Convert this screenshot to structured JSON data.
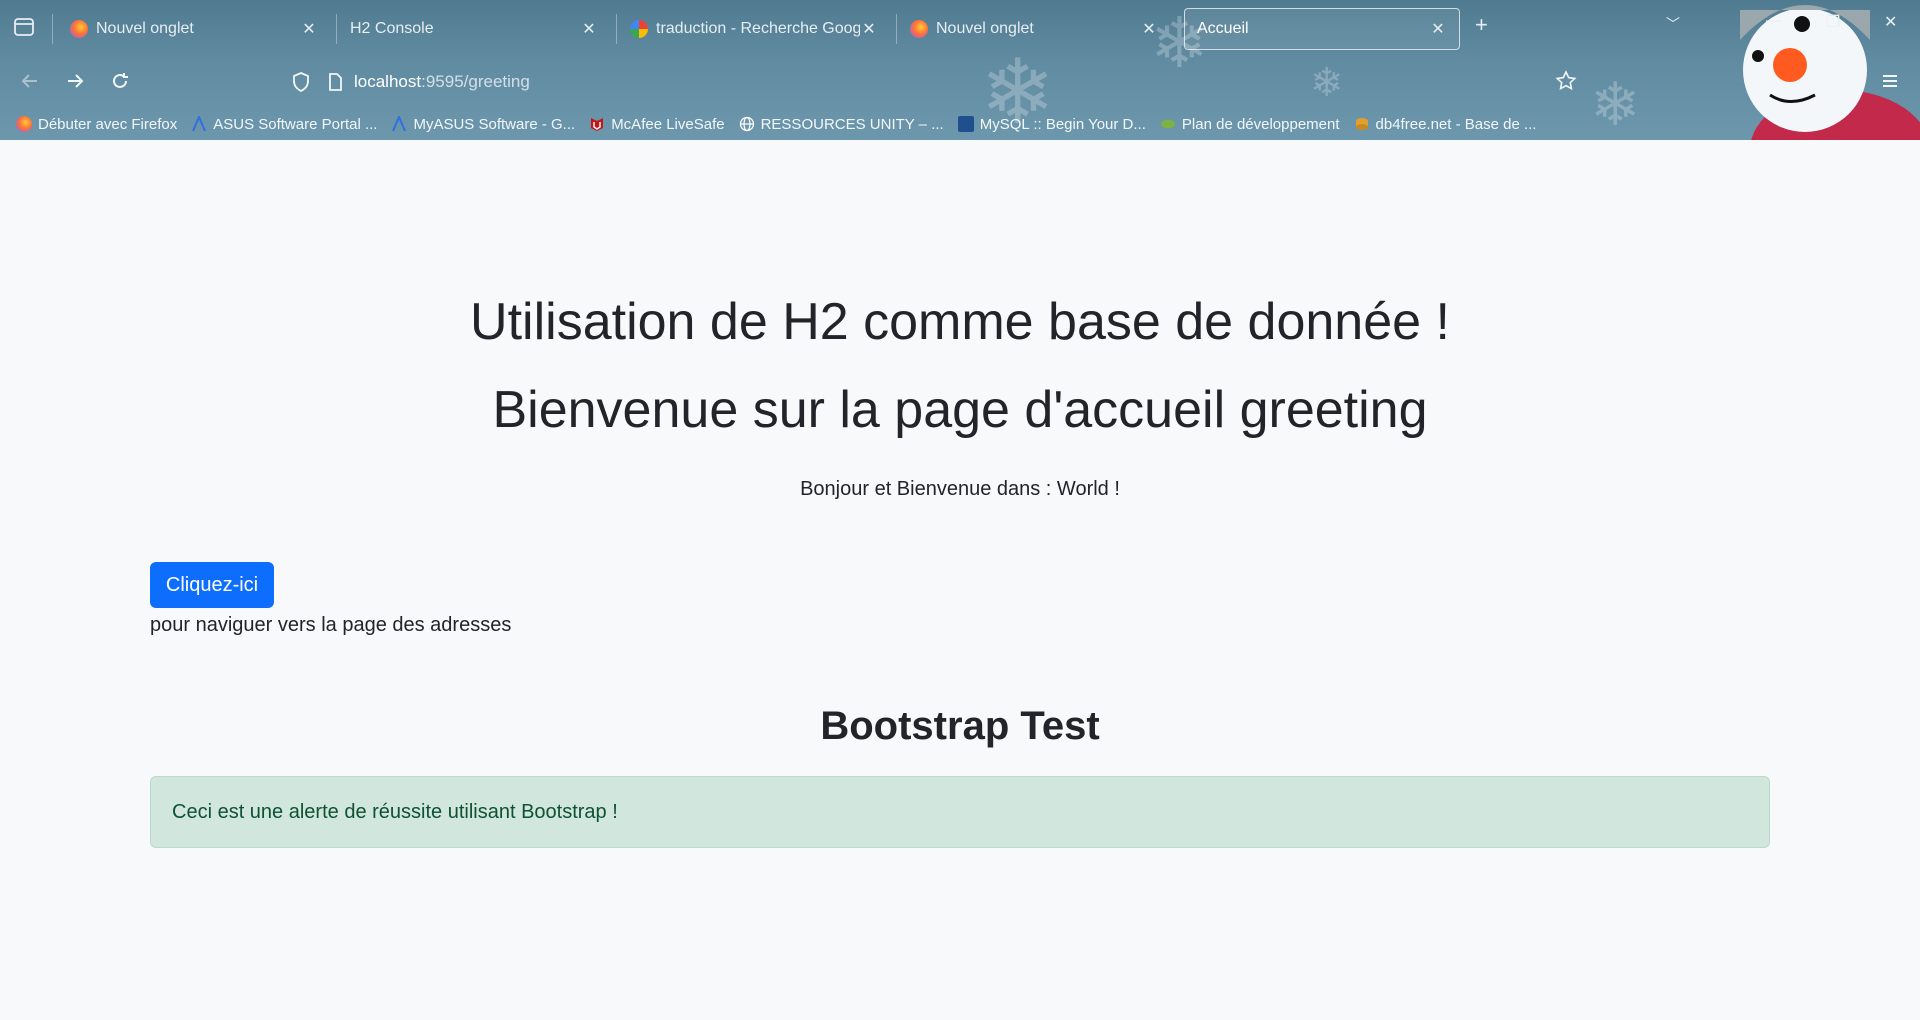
{
  "browser": {
    "tabs": [
      {
        "title": "Nouvel onglet",
        "icon": "firefox-icon",
        "active": false
      },
      {
        "title": "H2 Console",
        "icon": "none",
        "active": false
      },
      {
        "title": "traduction - Recherche Google",
        "icon": "google-icon",
        "active": false
      },
      {
        "title": "Nouvel onglet",
        "icon": "firefox-icon",
        "active": false
      },
      {
        "title": "Accueil",
        "icon": "none",
        "active": true
      }
    ],
    "close_glyph": "✕",
    "new_tab_glyph": "+",
    "url": {
      "host": "localhost",
      "path": ":9595/greeting"
    },
    "bookmarks": [
      {
        "label": "Débuter avec Firefox",
        "icon": "firefox-icon",
        "color": "#e66000"
      },
      {
        "label": "ASUS Software Portal ...",
        "icon": "asus-icon",
        "color": "#2f6fe0"
      },
      {
        "label": "MyASUS Software - G...",
        "icon": "asus-icon",
        "color": "#2f6fe0"
      },
      {
        "label": "McAfee LiveSafe",
        "icon": "mcafee-icon",
        "color": "#c01818"
      },
      {
        "label": "RESSOURCES UNITY – ...",
        "icon": "globe-icon",
        "color": "#ffffff"
      },
      {
        "label": "MySQL :: Begin Your D...",
        "icon": "mysql-icon",
        "color": "#1f4f8f"
      },
      {
        "label": "Plan de développement",
        "icon": "leaf-icon",
        "color": "#7cb342"
      },
      {
        "label": "db4free.net - Base de ...",
        "icon": "db-icon",
        "color": "#e0a030"
      }
    ]
  },
  "page": {
    "heading1": "Utilisation de H2 comme base de donnée !",
    "heading2": "Bienvenue sur la page d'accueil greeting",
    "greeting": "Bonjour et Bienvenue dans : World !",
    "button_label": "Cliquez-ici",
    "nav_note": "pour naviguer vers la page des adresses",
    "bootstrap_title": "Bootstrap Test",
    "alert_text": "Ceci est une alerte de réussite utilisant Bootstrap !"
  },
  "colors": {
    "primary": "#0d6efd",
    "alert_bg": "#d1e7dd",
    "alert_text": "#0f5132",
    "chrome": "#5a879c"
  }
}
